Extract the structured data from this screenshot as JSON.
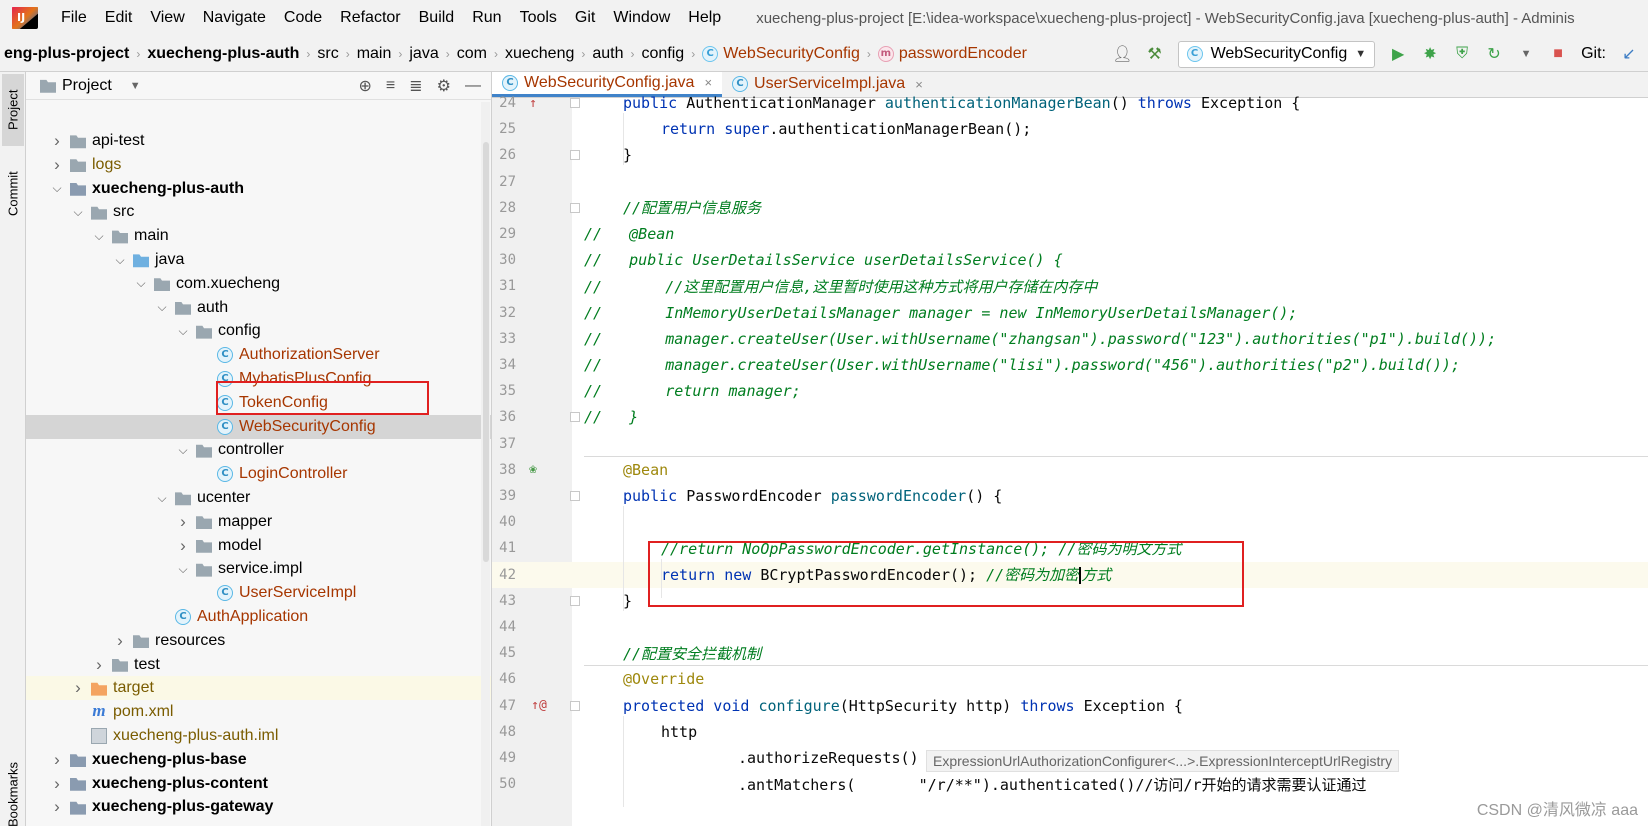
{
  "menu": {
    "items": [
      "File",
      "Edit",
      "View",
      "Navigate",
      "Code",
      "Refactor",
      "Build",
      "Run",
      "Tools",
      "Git",
      "Window",
      "Help"
    ],
    "window_title": "xuecheng-plus-project [E:\\idea-workspace\\xuecheng-plus-project] - WebSecurityConfig.java [xuecheng-plus-auth] - Adminis"
  },
  "breadcrumbs": {
    "items": [
      "eng-plus-project",
      "xuecheng-plus-auth",
      "src",
      "main",
      "java",
      "com",
      "xuecheng",
      "auth",
      "config",
      "WebSecurityConfig",
      "passwordEncoder"
    ],
    "run_config": "WebSecurityConfig",
    "git_label": "Git:"
  },
  "side_tabs": {
    "project": "Project",
    "commit": "Commit",
    "bookmarks": "Bookmarks"
  },
  "project_panel": {
    "title": "Project",
    "tree": [
      {
        "label": "api-test",
        "indent": 0,
        "arrow": "right",
        "icon": "folder-icon",
        "style": ""
      },
      {
        "label": "logs",
        "indent": 0,
        "arrow": "right",
        "icon": "folder-icon",
        "style": "brown"
      },
      {
        "label": "xuecheng-plus-auth",
        "indent": 0,
        "arrow": "down",
        "icon": "module-icon",
        "style": "bold"
      },
      {
        "label": "src",
        "indent": 1,
        "arrow": "down",
        "icon": "folder-icon",
        "style": ""
      },
      {
        "label": "main",
        "indent": 2,
        "arrow": "down",
        "icon": "folder-icon",
        "style": ""
      },
      {
        "label": "java",
        "indent": 3,
        "arrow": "down",
        "icon": "source-folder-icon",
        "style": ""
      },
      {
        "label": "com.xuecheng",
        "indent": 4,
        "arrow": "down",
        "icon": "package-icon",
        "style": ""
      },
      {
        "label": "auth",
        "indent": 5,
        "arrow": "down",
        "icon": "package-icon",
        "style": ""
      },
      {
        "label": "config",
        "indent": 6,
        "arrow": "down",
        "icon": "package-icon",
        "style": ""
      },
      {
        "label": "AuthorizationServer",
        "indent": 7,
        "arrow": "none",
        "icon": "class-icon",
        "style": "orange"
      },
      {
        "label": "MybatisPlusConfig",
        "indent": 7,
        "arrow": "none",
        "icon": "class-icon",
        "style": "orange"
      },
      {
        "label": "TokenConfig",
        "indent": 7,
        "arrow": "none",
        "icon": "class-icon",
        "style": "orange"
      },
      {
        "label": "WebSecurityConfig",
        "indent": 7,
        "arrow": "none",
        "icon": "class-icon",
        "style": "orange",
        "selected": true
      },
      {
        "label": "controller",
        "indent": 6,
        "arrow": "down",
        "icon": "package-icon",
        "style": ""
      },
      {
        "label": "LoginController",
        "indent": 7,
        "arrow": "none",
        "icon": "class-icon",
        "style": "orange"
      },
      {
        "label": "ucenter",
        "indent": 5,
        "arrow": "down",
        "icon": "package-icon",
        "style": ""
      },
      {
        "label": "mapper",
        "indent": 6,
        "arrow": "right",
        "icon": "package-icon",
        "style": ""
      },
      {
        "label": "model",
        "indent": 6,
        "arrow": "right",
        "icon": "package-icon",
        "style": ""
      },
      {
        "label": "service.impl",
        "indent": 6,
        "arrow": "down",
        "icon": "package-icon",
        "style": ""
      },
      {
        "label": "UserServiceImpl",
        "indent": 7,
        "arrow": "none",
        "icon": "class-icon",
        "style": "orange"
      },
      {
        "label": "AuthApplication",
        "indent": 5,
        "arrow": "none",
        "icon": "class-icon",
        "style": "orange"
      },
      {
        "label": "resources",
        "indent": 3,
        "arrow": "right",
        "icon": "resources-folder-icon",
        "style": ""
      },
      {
        "label": "test",
        "indent": 2,
        "arrow": "right",
        "icon": "folder-icon",
        "style": ""
      },
      {
        "label": "target",
        "indent": 1,
        "arrow": "right",
        "icon": "excluded-folder-icon",
        "style": "brown",
        "highlight": true
      },
      {
        "label": "pom.xml",
        "indent": 1,
        "arrow": "none",
        "icon": "maven-icon",
        "style": "brown"
      },
      {
        "label": "xuecheng-plus-auth.iml",
        "indent": 1,
        "arrow": "none",
        "icon": "iml-file-icon",
        "style": "brown"
      },
      {
        "label": "xuecheng-plus-base",
        "indent": 0,
        "arrow": "right",
        "icon": "module-icon",
        "style": "bold"
      },
      {
        "label": "xuecheng-plus-content",
        "indent": 0,
        "arrow": "right",
        "icon": "module-icon",
        "style": "bold"
      },
      {
        "label": "xuecheng-plus-gateway",
        "indent": 0,
        "arrow": "right",
        "icon": "module-icon",
        "style": "bold"
      }
    ]
  },
  "editor": {
    "tabs": [
      {
        "label": "WebSecurityConfig.java",
        "active": true
      },
      {
        "label": "UserServiceImpl.java",
        "active": false
      }
    ],
    "lines": [
      {
        "n": "24",
        "gutter": "override",
        "fold": true,
        "indent": 1,
        "tokens": [
          [
            "kw",
            "public "
          ],
          [
            "plain",
            "AuthenticationManager "
          ],
          [
            "fn",
            "authenticationManagerBean"
          ],
          [
            "plain",
            "() "
          ],
          [
            "kw",
            "throws "
          ],
          [
            "plain",
            "Exception {"
          ]
        ]
      },
      {
        "n": "25",
        "indent": 2,
        "tokens": [
          [
            "kw",
            "return super"
          ],
          [
            "plain",
            "."
          ],
          [
            "plain",
            "authenticationManagerBean"
          ],
          [
            "plain",
            "();"
          ]
        ]
      },
      {
        "n": "26",
        "fold": true,
        "indent": 1,
        "tokens": [
          [
            "plain",
            "}"
          ]
        ]
      },
      {
        "n": "27",
        "indent": 0,
        "tokens": []
      },
      {
        "n": "28",
        "fold": true,
        "indent": 1,
        "tokens": [
          [
            "cm-green",
            "//配置用户信息服务"
          ]
        ]
      },
      {
        "n": "29",
        "indent": 0,
        "tokens": [
          [
            "cm-green",
            "//   @Bean"
          ]
        ]
      },
      {
        "n": "30",
        "indent": 0,
        "tokens": [
          [
            "cm-green",
            "//   public UserDetailsService userDetailsService() {"
          ]
        ]
      },
      {
        "n": "31",
        "indent": 0,
        "tokens": [
          [
            "cm-green",
            "//       //这里配置用户信息,这里暂时使用这种方式将用户存储在内存中"
          ]
        ]
      },
      {
        "n": "32",
        "indent": 0,
        "tokens": [
          [
            "cm-green",
            "//       InMemoryUserDetailsManager manager = new InMemoryUserDetailsManager();"
          ]
        ]
      },
      {
        "n": "33",
        "indent": 0,
        "tokens": [
          [
            "cm-green",
            "//       manager.createUser(User.withUsername(\"zhangsan\").password(\"123\").authorities(\"p1\").build());"
          ]
        ]
      },
      {
        "n": "34",
        "indent": 0,
        "tokens": [
          [
            "cm-green",
            "//       manager.createUser(User.withUsername(\"lisi\").password(\"456\").authorities(\"p2\").build());"
          ]
        ]
      },
      {
        "n": "35",
        "indent": 0,
        "tokens": [
          [
            "cm-green",
            "//       return manager;"
          ]
        ]
      },
      {
        "n": "36",
        "fold": true,
        "indent": 0,
        "tokens": [
          [
            "cm-green",
            "//   }"
          ]
        ]
      },
      {
        "n": "37",
        "indent": 0,
        "tokens": []
      },
      {
        "n": "38",
        "gutter": "bean",
        "indent": 1,
        "tokens": [
          [
            "an",
            "@Bean"
          ]
        ]
      },
      {
        "n": "39",
        "fold": true,
        "indent": 1,
        "tokens": [
          [
            "kw",
            "public "
          ],
          [
            "plain",
            "PasswordEncoder "
          ],
          [
            "fn",
            "passwordEncoder"
          ],
          [
            "plain",
            "() {"
          ]
        ]
      },
      {
        "n": "40",
        "indent": 0,
        "tokens": []
      },
      {
        "n": "41",
        "indent": 2,
        "tokens": [
          [
            "cm-green",
            "//return NoOpPasswordEncoder.getInstance(); //密码为明文方式"
          ]
        ]
      },
      {
        "n": "42",
        "indent": 2,
        "current": true,
        "tokens": [
          [
            "kw",
            "return new "
          ],
          [
            "plain",
            "BCryptPasswordEncoder(); "
          ],
          [
            "cm-green",
            "//密码为加密"
          ],
          [
            "caret",
            ""
          ],
          [
            "cm-green",
            "方式"
          ]
        ]
      },
      {
        "n": "43",
        "fold": true,
        "indent": 1,
        "tokens": [
          [
            "plain",
            "}"
          ]
        ]
      },
      {
        "n": "44",
        "indent": 0,
        "tokens": []
      },
      {
        "n": "45",
        "indent": 1,
        "tokens": [
          [
            "cm-green",
            "//配置安全拦截机制"
          ]
        ]
      },
      {
        "n": "46",
        "indent": 1,
        "tokens": [
          [
            "an",
            "@Override"
          ]
        ]
      },
      {
        "n": "47",
        "gutter": "override-at",
        "fold": true,
        "indent": 1,
        "tokens": [
          [
            "kw",
            "protected void "
          ],
          [
            "fn",
            "configure"
          ],
          [
            "plain",
            "(HttpSecurity http) "
          ],
          [
            "kw",
            "throws "
          ],
          [
            "plain",
            "Exception {"
          ]
        ]
      },
      {
        "n": "48",
        "indent": 2,
        "tokens": [
          [
            "plain",
            "http"
          ]
        ]
      },
      {
        "n": "49",
        "indent": 4,
        "tokens": [
          [
            "plain",
            ".authorizeRequests()"
          ]
        ]
      },
      {
        "n": "50",
        "indent": 4,
        "tokens": [
          [
            "plain",
            ".antMatchers(       \"/r/**\").authenticated()//访问/r开始的请求需要认证通过"
          ]
        ]
      }
    ],
    "hint": "ExpressionUrlAuthorizationConfigurer<...>.ExpressionInterceptUrlRegistry",
    "watermark": "CSDN @清风微凉 aaa"
  },
  "colors": {
    "annotation_box": "#e02020",
    "selection": "#d5d5d5",
    "accent_tab": "#4083c9"
  }
}
